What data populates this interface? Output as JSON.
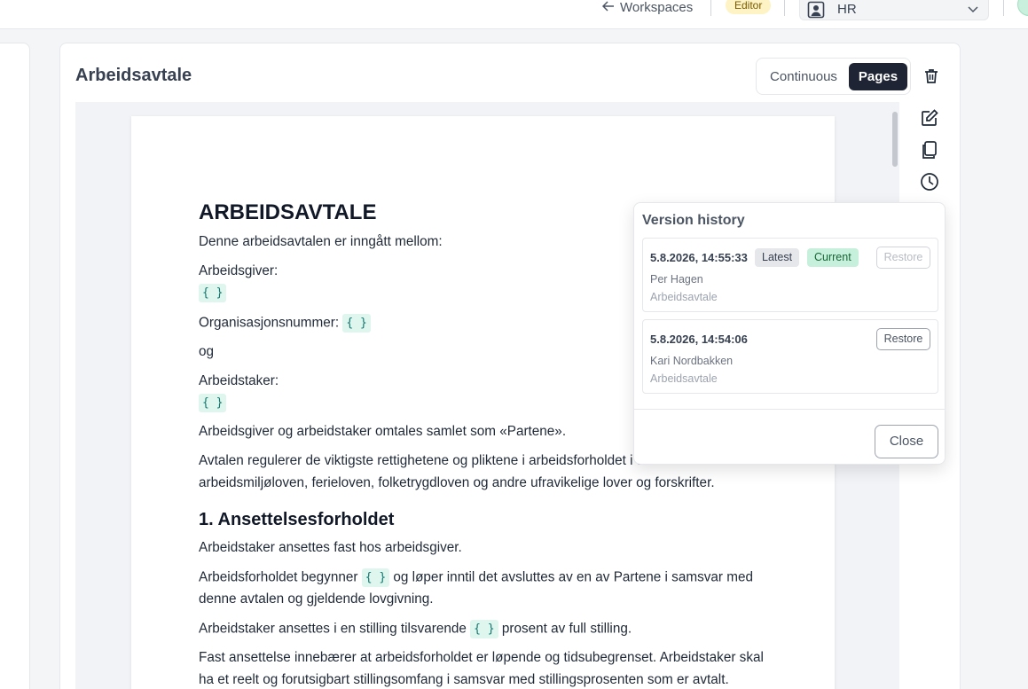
{
  "topbar": {
    "back_label": "Workspaces",
    "role_badge": "Editor",
    "workspace_select": "HR"
  },
  "document": {
    "title": "Arbeidsavtale",
    "view_toggle": {
      "continuous": "Continuous",
      "pages": "Pages",
      "active": "Pages"
    },
    "placeholder": "{ }",
    "heading": "ARBEIDSAVTALE",
    "lines": {
      "l1": "Denne arbeidsavtalen er inngått mellom:",
      "l2": "Arbeidsgiver:",
      "l3": "Organisasjonsnummer:",
      "l4": "og",
      "l5": "Arbeidstaker:",
      "l6": "Arbeidsgiver og arbeidstaker omtales samlet som «Partene».",
      "l7": "Avtalen regulerer de viktigste rettighetene og pliktene i arbeidsforholdet i tråd med",
      "l8": "arbeidsmiljøloven, ferieloven, folketrygdloven og andre ufravikelige lover og forskrifter.",
      "section1": "1. Ansettelsesforholdet",
      "l9": "Arbeidstaker ansettes fast hos arbeidsgiver.",
      "l10a": "Arbeidsforholdet begynner",
      "l10b": "og løper inntil det avsluttes av en av Partene i samsvar med",
      "l11": "denne avtalen og gjeldende lovgivning.",
      "l12a": "Arbeidstaker ansettes i en stilling tilsvarende",
      "l12b": "prosent av full stilling.",
      "l13": "Fast ansettelse innebærer at arbeidsforholdet er løpende og tidsubegrenset. Arbeidstaker skal",
      "l14": "ha et reelt og forutsigbart stillingsomfang i samsvar med stillingsprosenten som er avtalt."
    }
  },
  "version_history": {
    "title": "Version history",
    "versions": [
      {
        "timestamp": "5.8.2026, 14:55:33",
        "tags": [
          "Latest",
          "Current"
        ],
        "user": "Per Hagen",
        "doc": "Arbeidsavtale",
        "restore": "Restore",
        "restore_disabled": true
      },
      {
        "timestamp": "5.8.2026, 14:54:06",
        "tags": [],
        "user": "Kari Nordbakken",
        "doc": "Arbeidsavtale",
        "restore": "Restore",
        "restore_disabled": false
      }
    ],
    "close_label": "Close"
  },
  "icons": {
    "back": "arrow-left-icon",
    "workspace": "user-badge-icon",
    "dropdown": "chevron-down-icon",
    "delete": "trash-icon",
    "edit": "edit-icon",
    "copy": "copy-icon",
    "history": "clock-icon"
  },
  "colors": {
    "primary_dark": "#1e2433",
    "placeholder_bg": "#dff6ee",
    "current_tag_bg": "#c6f0dc",
    "editor_badge_bg": "#fdf3c4"
  }
}
